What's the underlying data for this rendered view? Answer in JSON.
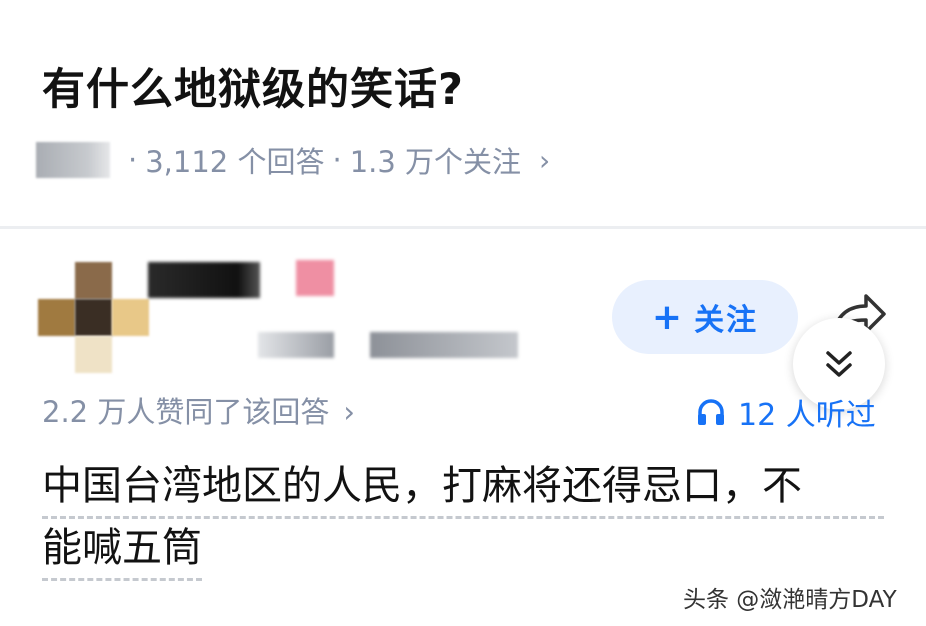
{
  "question": {
    "title": "有什么地狱级的笑话?",
    "answer_count": "3,112 个回答",
    "follower_count": "1.3 万个关注",
    "separator": "·",
    "chevron": "›"
  },
  "answer": {
    "follow_label": "关注",
    "follow_plus": "+",
    "vote_summary": "2.2 万人赞同了该回答",
    "chevron": "›",
    "listen_count": "12 人听过",
    "body_line_1": "中国台湾地区的人民，打麻将还得忌口，不",
    "body_line_2": "能喊五筒"
  },
  "watermark": "头条 @潋滟晴方DAY",
  "colors": {
    "accent": "#1772f6",
    "muted": "#8590a6",
    "follow_bg": "#e8f0fe"
  },
  "icons": [
    "share-icon",
    "double-chevron-down-icon",
    "headphones-icon",
    "plus-icon"
  ]
}
